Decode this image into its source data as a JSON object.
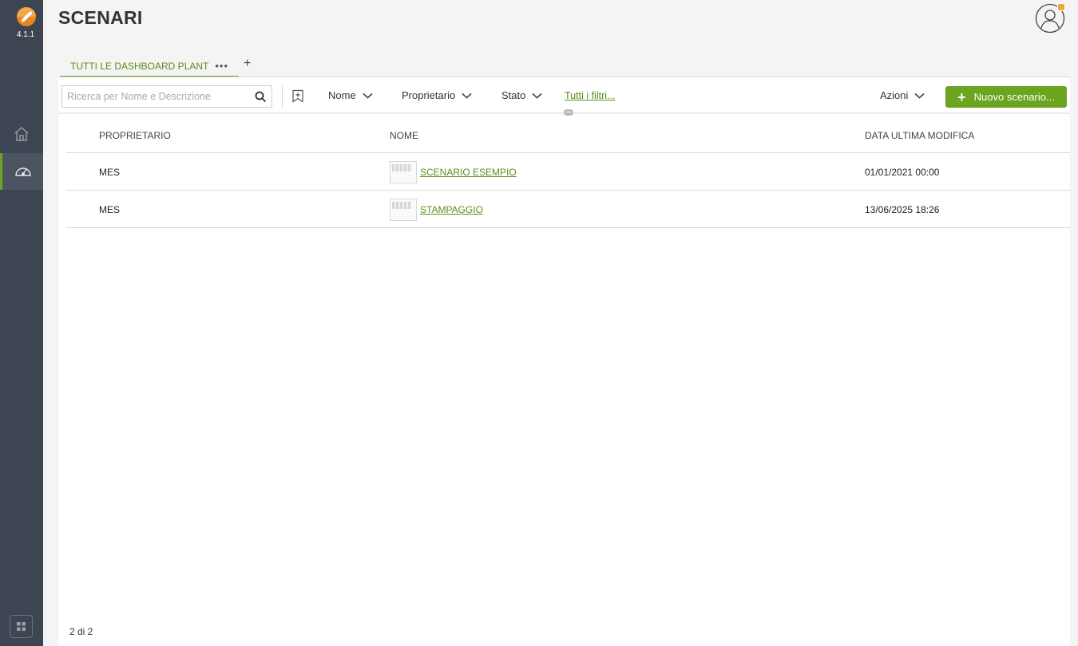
{
  "app": {
    "version": "4.1.1",
    "accent": "#6ba41f",
    "sidebar_bg": "#3d4452"
  },
  "sidebar": {
    "items": [
      "home-icon",
      "dashboard-gauge-icon",
      "apps-grid-icon"
    ]
  },
  "header": {
    "title": "SCENARI"
  },
  "tabs": [
    {
      "label": "TUTTI LE DASHBOARD PLANT",
      "more": "•••"
    }
  ],
  "tab_add": "+",
  "toolbar": {
    "search_placeholder": "Ricerca per Nome e Descrizione",
    "filters": [
      "Nome",
      "Proprietario",
      "Stato"
    ],
    "all_filters": "Tutti i filtri...",
    "actions": "Azioni",
    "new_button": "Nuovo scenario...",
    "new_button_plus": "+"
  },
  "table": {
    "columns": [
      "PROPRIETARIO",
      "NOME",
      "DATA ULTIMA MODIFICA"
    ],
    "rows": [
      {
        "owner": "MES",
        "name": "SCENARIO ESEMPIO",
        "modified": "01/01/2021 00:00"
      },
      {
        "owner": "MES",
        "name": "STAMPAGGIO",
        "modified": "13/06/2025 18:26"
      }
    ]
  },
  "footer": {
    "count": "2 di 2"
  }
}
